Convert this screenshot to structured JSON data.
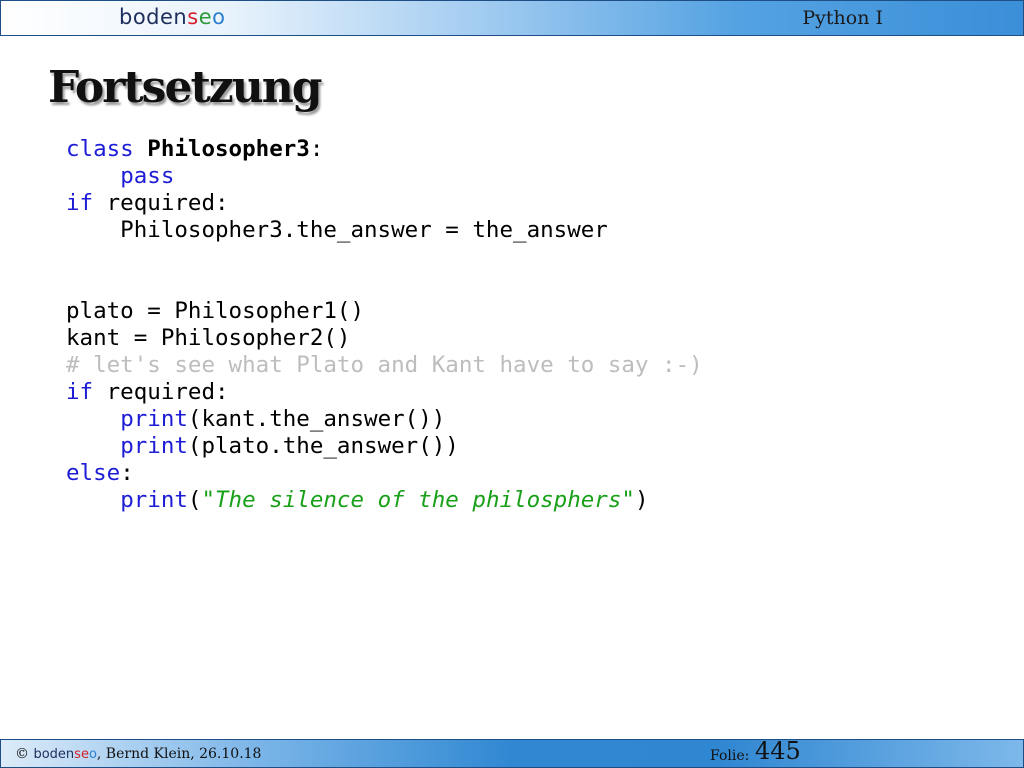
{
  "header": {
    "logo": {
      "part1": "boden",
      "part2": "s",
      "part3": "e",
      "part4": "o"
    },
    "course_title": "Python I"
  },
  "slide": {
    "title": "Fortsetzung"
  },
  "code": {
    "l1_kw": "class",
    "l1_sp": " ",
    "l1_name": "Philosopher3",
    "l1_colon": ":",
    "l2_indent": "    ",
    "l2_kw": "pass",
    "l3_kw": "if",
    "l3_rest": " required:",
    "l4_text": "    Philosopher3.the_answer = the_answer",
    "l7_text": "plato = Philosopher1()",
    "l8_text": "kant = Philosopher2()",
    "l9_comment": "# let's see what Plato and Kant have to say :-)",
    "l10_kw": "if",
    "l10_rest": " required:",
    "l11_indent": "    ",
    "l11_kw": "print",
    "l11_rest": "(kant.the_answer())",
    "l12_indent": "    ",
    "l12_kw": "print",
    "l12_rest": "(plato.the_answer())",
    "l13_kw": "else",
    "l13_colon": ":",
    "l14_indent": "    ",
    "l14_kw": "print",
    "l14_open": "(",
    "l14_string": "\"The silence of the philosphers\"",
    "l14_close": ")"
  },
  "footer": {
    "copyright": "© ",
    "logo": {
      "part1": "boden",
      "part2": "s",
      "part3": "e",
      "part4": "o"
    },
    "author_date": ", Bernd Klein, 26.10.18",
    "folie_label": "Folie:",
    "folie_number": "445"
  },
  "colors": {
    "keyword": "#1d1dd6",
    "comment": "#bdbdbd",
    "string": "#19a019",
    "bar_blue": "#3b8fd8"
  }
}
